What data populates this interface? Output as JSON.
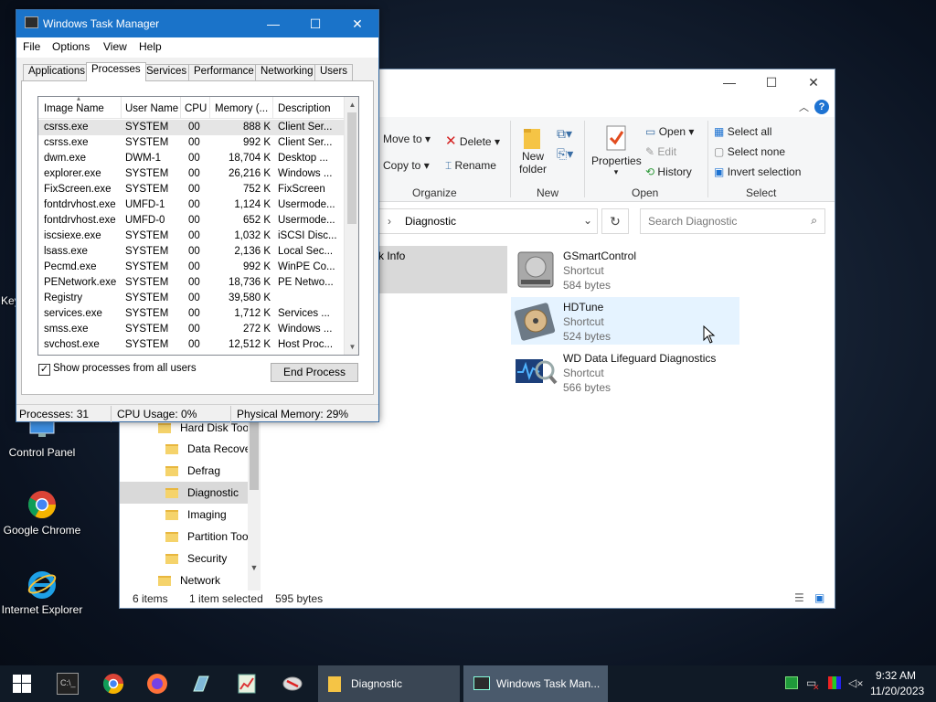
{
  "desktop": {
    "icons": [
      {
        "label": "Control Panel",
        "icon": "control-panel-icon"
      },
      {
        "label": "Google Chrome",
        "icon": "chrome-icon"
      },
      {
        "label": "Internet Explorer",
        "icon": "ie-icon"
      }
    ],
    "partial_label": "Key"
  },
  "explorer": {
    "ribbon": {
      "move_to": "Move to",
      "copy_to": "Copy to",
      "delete": "Delete",
      "rename": "Rename",
      "new_folder_1": "New",
      "new_folder_2": "folder",
      "properties": "Properties",
      "open": "Open",
      "edit": "Edit",
      "history": "History",
      "select_all": "Select all",
      "select_none": "Select none",
      "invert_selection": "Invert selection",
      "groups": {
        "organize": "Organize",
        "new": "New",
        "open": "Open",
        "select": "Select"
      }
    },
    "address": {
      "sep": "›",
      "current": "Diagnostic"
    },
    "search_placeholder": "Search Diagnostic",
    "nav": {
      "partial_item": "k Info",
      "items": [
        {
          "label": "Hard Disk Tools"
        },
        {
          "label": "Data Recovery"
        },
        {
          "label": "Defrag"
        },
        {
          "label": "Diagnostic"
        },
        {
          "label": "Imaging"
        },
        {
          "label": "Partition Tools"
        },
        {
          "label": "Security"
        },
        {
          "label": "Network"
        }
      ]
    },
    "files": [
      {
        "name": "GSmartControl",
        "type": "Shortcut",
        "size": "584 bytes"
      },
      {
        "name": "HDTune",
        "type": "Shortcut",
        "size": "524 bytes"
      },
      {
        "name": "WD Data Lifeguard Diagnostics",
        "type": "Shortcut",
        "size": "566 bytes"
      }
    ],
    "status": {
      "items": "6 items",
      "selected": "1 item selected",
      "size": "595 bytes"
    }
  },
  "taskmgr": {
    "title": "Windows Task Manager",
    "menu": [
      "File",
      "Options",
      "View",
      "Help"
    ],
    "tabs": [
      "Applications",
      "Processes",
      "Services",
      "Performance",
      "Networking",
      "Users"
    ],
    "active_tab": "Processes",
    "columns": [
      "Image Name",
      "User Name",
      "CPU",
      "Memory (...",
      "Description"
    ],
    "rows": [
      {
        "image": "csrss.exe",
        "user": "SYSTEM",
        "cpu": "00",
        "mem": "888 K",
        "desc": "Client Ser..."
      },
      {
        "image": "csrss.exe",
        "user": "SYSTEM",
        "cpu": "00",
        "mem": "992 K",
        "desc": "Client Ser..."
      },
      {
        "image": "dwm.exe",
        "user": "DWM-1",
        "cpu": "00",
        "mem": "18,704 K",
        "desc": "Desktop ..."
      },
      {
        "image": "explorer.exe",
        "user": "SYSTEM",
        "cpu": "00",
        "mem": "26,216 K",
        "desc": "Windows ..."
      },
      {
        "image": "FixScreen.exe",
        "user": "SYSTEM",
        "cpu": "00",
        "mem": "752 K",
        "desc": "FixScreen"
      },
      {
        "image": "fontdrvhost.exe",
        "user": "UMFD-1",
        "cpu": "00",
        "mem": "1,124 K",
        "desc": "Usermode..."
      },
      {
        "image": "fontdrvhost.exe",
        "user": "UMFD-0",
        "cpu": "00",
        "mem": "652 K",
        "desc": "Usermode..."
      },
      {
        "image": "iscsiexe.exe",
        "user": "SYSTEM",
        "cpu": "00",
        "mem": "1,032 K",
        "desc": "iSCSI Disc..."
      },
      {
        "image": "lsass.exe",
        "user": "SYSTEM",
        "cpu": "00",
        "mem": "2,136 K",
        "desc": "Local Sec..."
      },
      {
        "image": "Pecmd.exe",
        "user": "SYSTEM",
        "cpu": "00",
        "mem": "992 K",
        "desc": "WinPE Co..."
      },
      {
        "image": "PENetwork.exe",
        "user": "SYSTEM",
        "cpu": "00",
        "mem": "18,736 K",
        "desc": "PE Netwo..."
      },
      {
        "image": "Registry",
        "user": "SYSTEM",
        "cpu": "00",
        "mem": "39,580 K",
        "desc": ""
      },
      {
        "image": "services.exe",
        "user": "SYSTEM",
        "cpu": "00",
        "mem": "1,712 K",
        "desc": "Services ..."
      },
      {
        "image": "smss.exe",
        "user": "SYSTEM",
        "cpu": "00",
        "mem": "272 K",
        "desc": "Windows ..."
      },
      {
        "image": "svchost.exe",
        "user": "SYSTEM",
        "cpu": "00",
        "mem": "12,512 K",
        "desc": "Host Proc..."
      }
    ],
    "show_all_label": "Show processes from all users",
    "show_all_checked": "✓",
    "end_process": "End Process",
    "status": {
      "processes": "Processes: 31",
      "cpu": "CPU Usage: 0%",
      "memory": "Physical Memory: 29%"
    }
  },
  "taskbar": {
    "apps": [
      {
        "label": "Diagnostic",
        "icon": "folder-icon"
      },
      {
        "label": "Windows Task Man...",
        "icon": "task-manager-icon"
      }
    ],
    "time": "9:32 AM",
    "date": "11/20/2023"
  },
  "colors": {
    "accent": "#1a73c9",
    "taskbar": "#101a26",
    "selection": "#cce8ff"
  }
}
